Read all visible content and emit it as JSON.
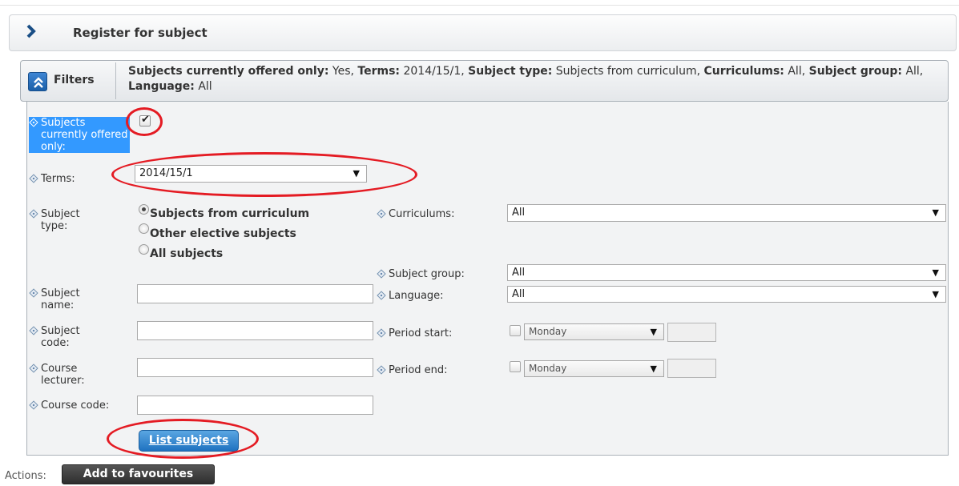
{
  "header": {
    "title": "Register for subject"
  },
  "filters": {
    "title": "Filters",
    "summary": [
      {
        "key": "Subjects currently offered only:",
        "value": " Yes, "
      },
      {
        "key": "Terms:",
        "value": " 2014/15/1, "
      },
      {
        "key": "Subject type:",
        "value": " Subjects from curriculum, "
      },
      {
        "key": "Curriculums:",
        "value": " All, "
      },
      {
        "key": "Subject group:",
        "value": " All, "
      },
      {
        "key": "Language:",
        "value": " All"
      }
    ]
  },
  "form": {
    "offered_label": "Subjects currently offered only:",
    "offered_checked": true,
    "terms_label": "Terms:",
    "terms_value": "2014/15/1",
    "subject_type_label": "Subject type:",
    "subject_type_options": [
      "Subjects from curriculum",
      "Other elective subjects",
      "All subjects"
    ],
    "subject_type_selected": 0,
    "curriculums_label": "Curriculums:",
    "curriculums_value": "All",
    "subject_group_label": "Subject group:",
    "subject_group_value": "All",
    "subject_name_label": "Subject name:",
    "language_label": "Language:",
    "language_value": "All",
    "subject_code_label": "Subject code:",
    "period_start_label": "Period start:",
    "period_start_day": "Monday",
    "course_lecturer_label": "Course lecturer:",
    "period_end_label": "Period end:",
    "period_end_day": "Monday",
    "course_code_label": "Course code:",
    "list_button": "List subjects"
  },
  "actions": {
    "label": "Actions:",
    "favourites_button": "Add to favourites"
  },
  "colors": {
    "annotation_ring": "#e41b23",
    "primary_button": "#1f72c0",
    "selection": "#3399ff"
  },
  "icons": {
    "header": "chevron-right-icon",
    "filters_toggle": "double-chevron-up-icon",
    "label_bullet": "diamond-icon"
  }
}
